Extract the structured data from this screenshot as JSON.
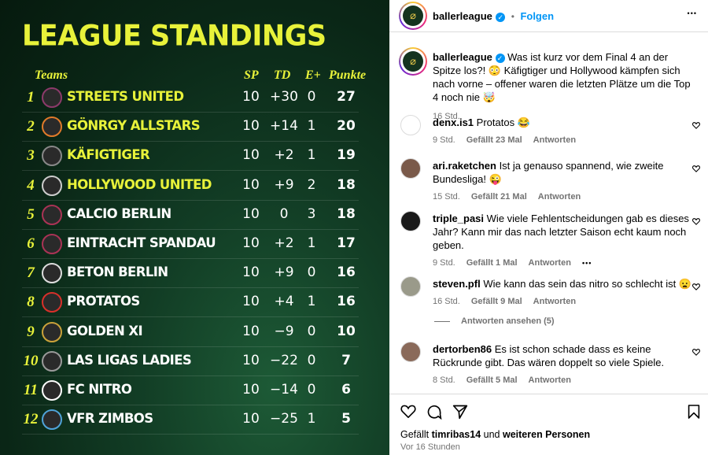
{
  "image": {
    "title": "LEAGUE STANDINGS",
    "headers": {
      "teams": "Teams",
      "sp": "SP",
      "td": "TD",
      "e": "E+",
      "pts": "Punkte"
    },
    "rows": [
      {
        "rank": "1",
        "team": "STREETS UNITED",
        "sp": "10",
        "td": "+30",
        "e": "0",
        "pts": "27",
        "color": "#e8f23a"
      },
      {
        "rank": "2",
        "team": "GÖNRGY ALLSTARS",
        "sp": "10",
        "td": "+14",
        "e": "1",
        "pts": "20",
        "color": "#e8f23a"
      },
      {
        "rank": "3",
        "team": "KÄFIGTIGER",
        "sp": "10",
        "td": "+2",
        "e": "1",
        "pts": "19",
        "color": "#e8f23a"
      },
      {
        "rank": "4",
        "team": "HOLLYWOOD UNITED",
        "sp": "10",
        "td": "+9",
        "e": "2",
        "pts": "18",
        "color": "#e8f23a"
      },
      {
        "rank": "5",
        "team": "CALCIO BERLIN",
        "sp": "10",
        "td": "0",
        "e": "3",
        "pts": "18",
        "color": "#ffffff"
      },
      {
        "rank": "6",
        "team": "EINTRACHT SPANDAU",
        "sp": "10",
        "td": "+2",
        "e": "1",
        "pts": "17",
        "color": "#ffffff"
      },
      {
        "rank": "7",
        "team": "BETON BERLIN",
        "sp": "10",
        "td": "+9",
        "e": "0",
        "pts": "16",
        "color": "#ffffff"
      },
      {
        "rank": "8",
        "team": "PROTATOS",
        "sp": "10",
        "td": "+4",
        "e": "1",
        "pts": "16",
        "color": "#ffffff"
      },
      {
        "rank": "9",
        "team": "GOLDEN XI",
        "sp": "10",
        "td": "−9",
        "e": "0",
        "pts": "10",
        "color": "#ffffff"
      },
      {
        "rank": "10",
        "team": "LAS LIGAS LADIES",
        "sp": "10",
        "td": "−22",
        "e": "0",
        "pts": "7",
        "color": "#ffffff"
      },
      {
        "rank": "11",
        "team": "FC NITRO",
        "sp": "10",
        "td": "−14",
        "e": "0",
        "pts": "6",
        "color": "#ffffff"
      },
      {
        "rank": "12",
        "team": "VFR ZIMBOS",
        "sp": "10",
        "td": "−25",
        "e": "1",
        "pts": "5",
        "color": "#ffffff"
      }
    ],
    "logo_colors": [
      "#8c3a6a",
      "#e07a2a",
      "#888888",
      "#cccccc",
      "#aa3355",
      "#aa3355",
      "#dddddd",
      "#d8302a",
      "#caa23a",
      "#9a9a9a",
      "#ffffff",
      "#4fa3d8"
    ]
  },
  "header": {
    "username": "ballerleague",
    "dot": "•",
    "follow": "Folgen",
    "more": "•••"
  },
  "caption": {
    "username": "ballerleague",
    "text": "Was ist kurz vor dem Final 4 an der Spitze los?! 😳 Käfigtiger und Hollywood kämpfen sich nach vorne – offener waren die letzten Plätze um die Top 4 noch nie 🤯",
    "time": "16 Std."
  },
  "comments": [
    {
      "user": "denx.is1",
      "text": "Protatos 😂",
      "time": "9 Std.",
      "likes": "Gefällt 23 Mal",
      "reply": "Antworten",
      "avatar_color": "#ffffff"
    },
    {
      "user": "ari.raketchen",
      "text": "Ist ja genauso spannend, wie zweite Bundesliga! 😜",
      "time": "15 Std.",
      "likes": "Gefällt 21 Mal",
      "reply": "Antworten",
      "avatar_color": "#7a5a4a"
    },
    {
      "user": "triple_pasi",
      "text": "Wie viele Fehlentscheidungen gab es dieses Jahr? Kann mir das nach letzter Saison echt kaum noch geben.",
      "time": "9 Std.",
      "likes": "Gefällt 1 Mal",
      "reply": "Antworten",
      "more": "•••",
      "avatar_color": "#1a1a1a"
    },
    {
      "user": "steven.pfl",
      "text": "Wie kann das sein das nitro so schlecht ist 😦",
      "time": "16 Std.",
      "likes": "Gefällt 9 Mal",
      "reply": "Antworten",
      "avatar_color": "#9a9a8a"
    },
    {
      "user": "dertorben86",
      "text": "Es ist schon schade dass es keine Rückrunde gibt. Das wären doppelt so viele Spiele.",
      "time": "8 Std.",
      "likes": "Gefällt 5 Mal",
      "reply": "Antworten",
      "avatar_color": "#8a6a5a"
    }
  ],
  "view_replies": "Antworten ansehen (5)",
  "likes_line": {
    "prefix": "Gefällt",
    "user": "timribas14",
    "mid": "und",
    "others": "weiteren Personen"
  },
  "post_time": "Vor 16 Stunden"
}
